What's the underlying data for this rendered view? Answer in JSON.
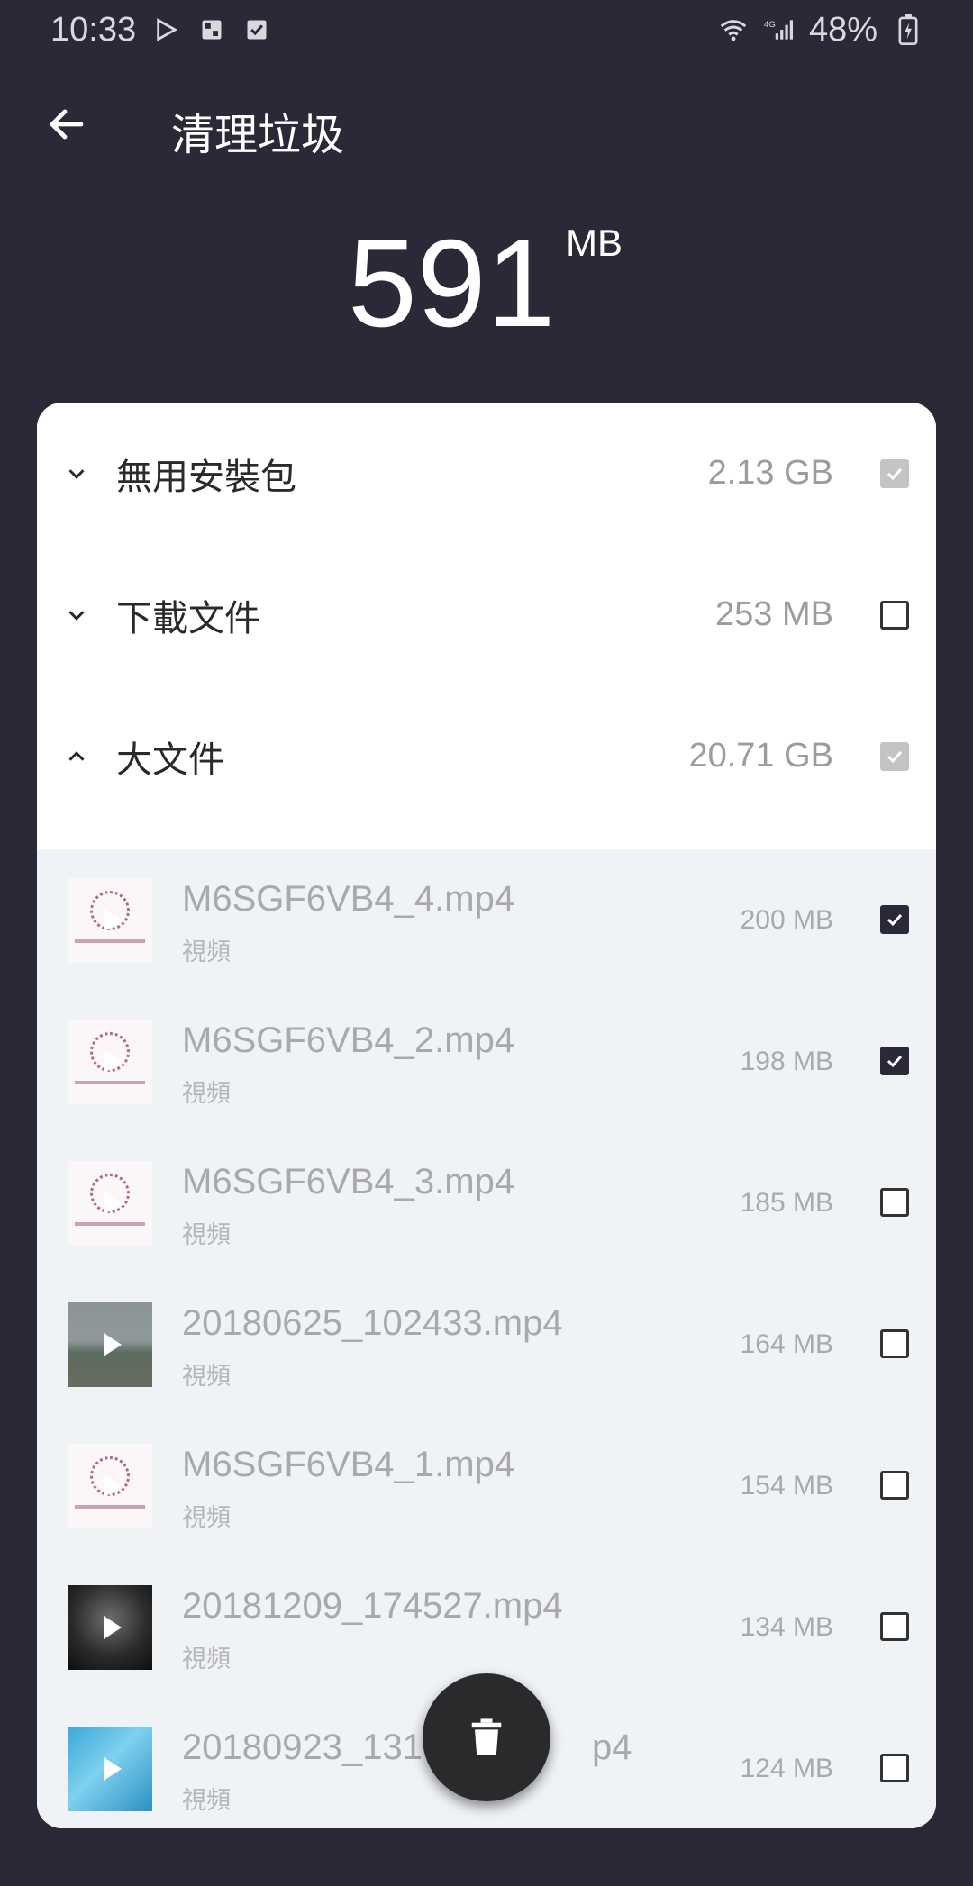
{
  "status_bar": {
    "time": "10:33",
    "battery": "48%",
    "icons": [
      "play-store-icon",
      "sim-icon",
      "checkbox-notification-icon",
      "wifi-icon",
      "4g-signal-icon",
      "battery-charging-icon"
    ]
  },
  "app_bar": {
    "title": "清理垃圾",
    "back_icon": "arrow-left-icon"
  },
  "total": {
    "value": "591",
    "unit": "MB"
  },
  "categories": [
    {
      "label": "無用安裝包",
      "size": "2.13 GB",
      "expanded": false,
      "check_state": "partial"
    },
    {
      "label": "下載文件",
      "size": "253 MB",
      "expanded": false,
      "check_state": "unchecked"
    },
    {
      "label": "大文件",
      "size": "20.71 GB",
      "expanded": true,
      "check_state": "partial"
    }
  ],
  "files": [
    {
      "name": "M6SGF6VB4_4.mp4",
      "type": "視頻",
      "size": "200 MB",
      "checked": true,
      "thumb": "logo"
    },
    {
      "name": "M6SGF6VB4_2.mp4",
      "type": "視頻",
      "size": "198 MB",
      "checked": true,
      "thumb": "logo"
    },
    {
      "name": "M6SGF6VB4_3.mp4",
      "type": "視頻",
      "size": "185 MB",
      "checked": false,
      "thumb": "logo"
    },
    {
      "name": "20180625_102433.mp4",
      "type": "視頻",
      "size": "164 MB",
      "checked": false,
      "thumb": "photo-a"
    },
    {
      "name": "M6SGF6VB4_1.mp4",
      "type": "視頻",
      "size": "154 MB",
      "checked": false,
      "thumb": "logo"
    },
    {
      "name": "20181209_174527.mp4",
      "type": "視頻",
      "size": "134 MB",
      "checked": false,
      "thumb": "photo-b"
    },
    {
      "name": "20180923_131",
      "name_suffix": "p4",
      "type": "視頻",
      "size": "124 MB",
      "checked": false,
      "thumb": "photo-c"
    }
  ],
  "fab": {
    "icon": "trash-icon"
  },
  "colors": {
    "background": "#2b2837",
    "card": "#ffffff",
    "list_bg": "#f0f3f6",
    "checked": "#2b2837"
  }
}
